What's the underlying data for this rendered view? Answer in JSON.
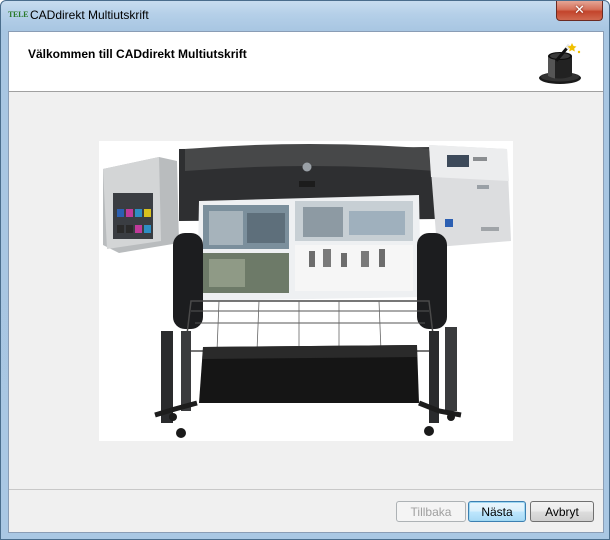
{
  "window": {
    "app_icon_text": "TELE",
    "title": "CADdirekt Multiutskrift",
    "close_glyph": "✕"
  },
  "header": {
    "title": "Välkommen till CADdirekt Multiutskrift",
    "icon": "wizard-hat-icon"
  },
  "content": {
    "image": "plotter-printer-photo"
  },
  "buttons": {
    "back": "Tillbaka",
    "next": "Nästa",
    "cancel": "Avbryt"
  },
  "colors": {
    "window_frame": "#a9c7e3",
    "close_button": "#c3442b",
    "client_bg": "#f0f0f0",
    "default_button_border": "#3c7fb1"
  }
}
